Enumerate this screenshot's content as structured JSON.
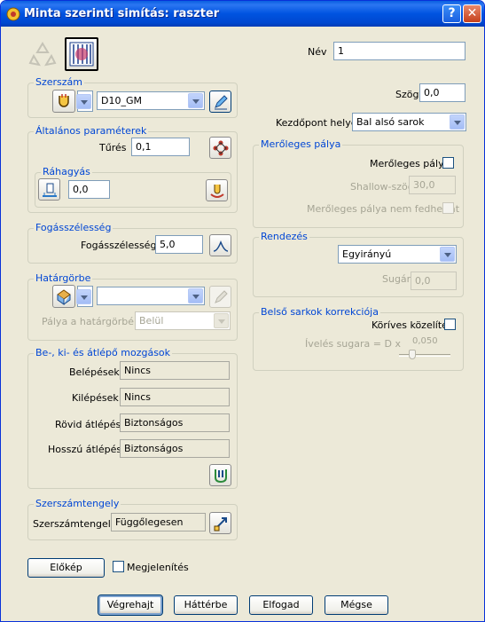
{
  "window": {
    "title": "Minta szerinti simítás: raszter",
    "help_label": "?",
    "close_label": "✕"
  },
  "top": {
    "name_label": "Név",
    "name_value": "1"
  },
  "tool": {
    "group_label": "Szerszám",
    "tool_value": "D10_GM"
  },
  "general": {
    "group_label": "Általános paraméterek",
    "tolerance_label": "Tűrés",
    "tolerance_value": "0,1",
    "allowance_group_label": "Ráhagyás",
    "allowance_value": "0,0"
  },
  "stepover": {
    "group_label": "Fogásszélesség",
    "label": "Fogásszélesség",
    "value": "5,0"
  },
  "boundary": {
    "group_label": "Határgörbe",
    "boundary_value": "",
    "path_label": "Pálya a határgörbén",
    "path_value": "Belül"
  },
  "leads": {
    "group_label": "Be-, ki- és átlépő mozgások",
    "rows": [
      {
        "label": "Belépések",
        "value": "Nincs"
      },
      {
        "label": "Kilépések",
        "value": "Nincs"
      },
      {
        "label": "Rövid átlépés",
        "value": "Biztonságos"
      },
      {
        "label": "Hosszú átlépés",
        "value": "Biztonságos"
      }
    ]
  },
  "axis": {
    "group_label": "Szerszámtengely",
    "label": "Szerszámtengely",
    "value": "Függőlegesen"
  },
  "right": {
    "angle_label": "Szög",
    "angle_value": "0,0",
    "start_label": "Kezdőpont helye",
    "start_value": "Bal alsó sarok"
  },
  "perpendicular": {
    "group_label": "Merőleges pálya",
    "checkbox_label": "Merőleges pálya",
    "shallow_label": "Shallow-szög",
    "shallow_value": "30,0",
    "no_overlap_label": "Merőleges pálya nem fedhet át"
  },
  "ordering": {
    "group_label": "Rendezés",
    "order_value": "Egyirányú",
    "radius_label": "Sugár",
    "radius_value": "0,0"
  },
  "corner": {
    "group_label": "Belső sarkok korrekciója",
    "arc_label": "Köríves közelítés",
    "radius_label": "Ívelés sugara = D x",
    "radius_value": "0,050"
  },
  "preview": {
    "button_label": "Előkép",
    "display_label": "Megjelenítés"
  },
  "footer": {
    "execute": "Végrehajt",
    "background": "Háttérbe",
    "accept": "Elfogad",
    "cancel": "Mégse"
  },
  "colors": {
    "title_bar": "#0053E0",
    "group_title": "#0046D5",
    "dialog_bg": "#ECE9D8"
  }
}
